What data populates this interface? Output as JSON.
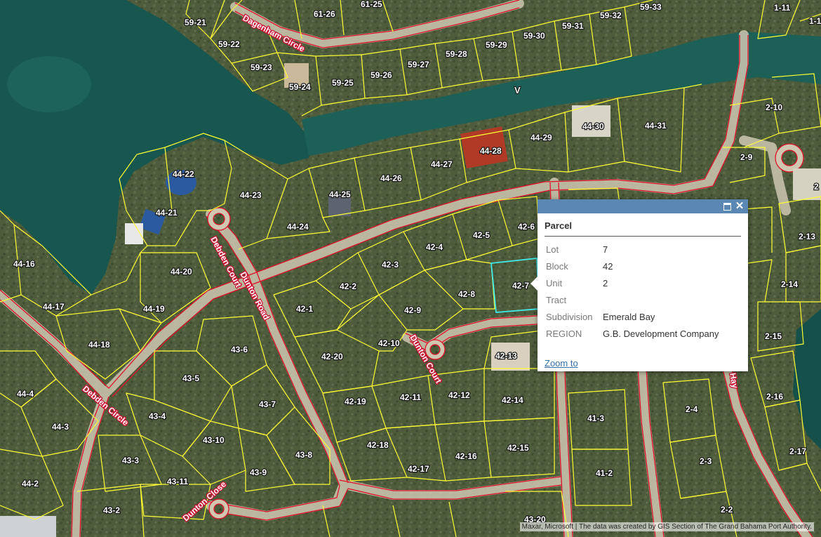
{
  "map": {
    "water_label": "V",
    "lots": [
      {
        "id": "61-26"
      },
      {
        "id": "61-25"
      },
      {
        "id": "59-21"
      },
      {
        "id": "59-22"
      },
      {
        "id": "59-23"
      },
      {
        "id": "59-24"
      },
      {
        "id": "59-25"
      },
      {
        "id": "59-26"
      },
      {
        "id": "59-27"
      },
      {
        "id": "59-28"
      },
      {
        "id": "59-29"
      },
      {
        "id": "59-30"
      },
      {
        "id": "59-31"
      },
      {
        "id": "59-32"
      },
      {
        "id": "59-33"
      },
      {
        "id": "1-11"
      },
      {
        "id": "1-1"
      },
      {
        "id": "2-10"
      },
      {
        "id": "2-9"
      },
      {
        "id": "2-13"
      },
      {
        "id": "2-14"
      },
      {
        "id": "2-15"
      },
      {
        "id": "2-16"
      },
      {
        "id": "2-17"
      },
      {
        "id": "2-4"
      },
      {
        "id": "2-3"
      },
      {
        "id": "2-2"
      },
      {
        "id": "2"
      },
      {
        "id": "44-22"
      },
      {
        "id": "44-21"
      },
      {
        "id": "44-23"
      },
      {
        "id": "44-24"
      },
      {
        "id": "44-25"
      },
      {
        "id": "44-26"
      },
      {
        "id": "44-27"
      },
      {
        "id": "44-28"
      },
      {
        "id": "44-29"
      },
      {
        "id": "44-30"
      },
      {
        "id": "44-31"
      },
      {
        "id": "44-16"
      },
      {
        "id": "44-20"
      },
      {
        "id": "44-17"
      },
      {
        "id": "44-19"
      },
      {
        "id": "44-18"
      },
      {
        "id": "44-4"
      },
      {
        "id": "44-3"
      },
      {
        "id": "44-2"
      },
      {
        "id": "42-4"
      },
      {
        "id": "42-5"
      },
      {
        "id": "42-6"
      },
      {
        "id": "42-3"
      },
      {
        "id": "42-2"
      },
      {
        "id": "42-1"
      },
      {
        "id": "42-7"
      },
      {
        "id": "42-8"
      },
      {
        "id": "42-9"
      },
      {
        "id": "42-10"
      },
      {
        "id": "42-20"
      },
      {
        "id": "42-13"
      },
      {
        "id": "42-19"
      },
      {
        "id": "42-11"
      },
      {
        "id": "42-12"
      },
      {
        "id": "42-14"
      },
      {
        "id": "42-18"
      },
      {
        "id": "42-16"
      },
      {
        "id": "42-15"
      },
      {
        "id": "42-17"
      },
      {
        "id": "43-6"
      },
      {
        "id": "43-5"
      },
      {
        "id": "43-7"
      },
      {
        "id": "43-4"
      },
      {
        "id": "43-10"
      },
      {
        "id": "43-3"
      },
      {
        "id": "43-8"
      },
      {
        "id": "43-9"
      },
      {
        "id": "43-11"
      },
      {
        "id": "43-2"
      },
      {
        "id": "43-20"
      },
      {
        "id": "41-3"
      },
      {
        "id": "41-2"
      }
    ],
    "roads": [
      {
        "name": "Dagenham Circle"
      },
      {
        "name": "Debden Court"
      },
      {
        "name": "Dunton Road"
      },
      {
        "name": "Dunton Court"
      },
      {
        "name": "Debden Circle"
      },
      {
        "name": "Dunton Close"
      },
      {
        "name": "Hay"
      }
    ]
  },
  "popup": {
    "title": "Parcel",
    "fields": [
      {
        "key": "Lot",
        "value": "7"
      },
      {
        "key": "Block",
        "value": "42"
      },
      {
        "key": "Unit",
        "value": "2"
      },
      {
        "key": "Tract",
        "value": ""
      },
      {
        "key": "Subdivision",
        "value": "Emerald Bay"
      },
      {
        "key": "REGION",
        "value": "G.B. Development Company"
      }
    ],
    "zoom_label": "Zoom to",
    "maximize_icon": "maximize-icon",
    "close_icon": "close-icon"
  },
  "attribution": "Maxar, Microsoft | The data was created by GIS Section of The Grand Bahama Port Authority.",
  "colors": {
    "water": "#17574f",
    "land": "#4a5a38",
    "parcel_line": "#ffff33",
    "road_line": "#e0102a",
    "selected_parcel": "#40e8e8",
    "popup_header": "#5b87b4",
    "link": "#3a6ea5"
  }
}
